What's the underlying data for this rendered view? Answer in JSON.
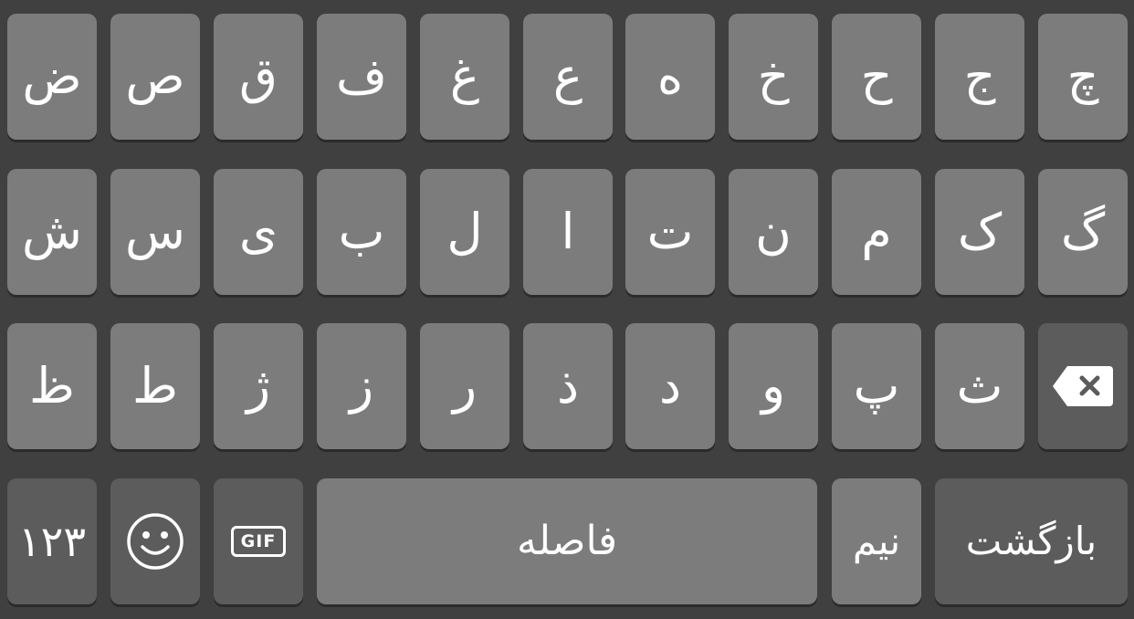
{
  "keyboard": {
    "row1": [
      "ض",
      "ص",
      "ق",
      "ف",
      "غ",
      "ع",
      "ه",
      "خ",
      "ح",
      "ج",
      "چ"
    ],
    "row2": [
      "ش",
      "س",
      "ی",
      "ب",
      "ل",
      "ا",
      "ت",
      "ن",
      "م",
      "ک",
      "گ"
    ],
    "row3": [
      "ظ",
      "ط",
      "ژ",
      "ز",
      "ر",
      "ذ",
      "د",
      "و",
      "پ",
      "ث"
    ],
    "bottom": {
      "numbers_label": "۱۲۳",
      "gif_label": "GIF",
      "space_label": "فاصله",
      "zwnj_label": "نیم",
      "return_label": "بازگشت"
    },
    "icons": {
      "backspace": "backspace-icon",
      "emoji": "emoji-icon",
      "gif": "gif-icon"
    },
    "colors": {
      "background": "#404040",
      "key": "#7c7c7c",
      "key_dark": "#5c5c5c",
      "text": "#ffffff"
    }
  }
}
